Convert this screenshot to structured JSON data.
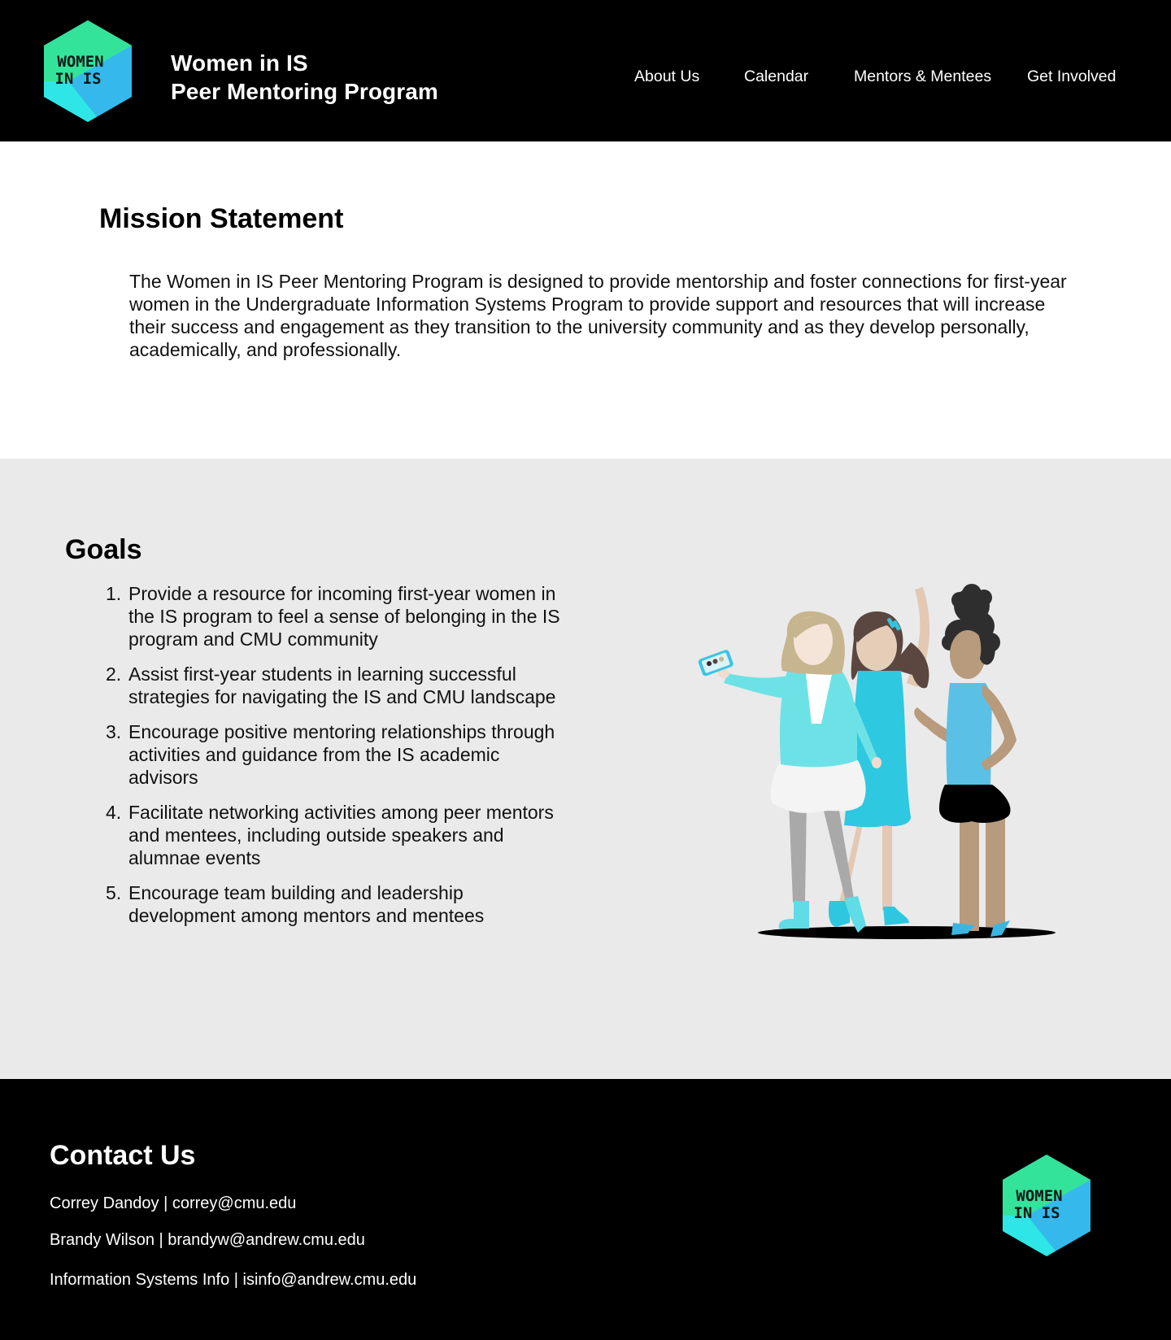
{
  "header": {
    "logo_text": [
      "WOMEN",
      "IN IS"
    ],
    "title_line1": "Women in IS",
    "title_line2": "Peer Mentoring Program",
    "nav": [
      {
        "label": "About Us"
      },
      {
        "label": "Calendar"
      },
      {
        "label": "Mentors & Mentees"
      },
      {
        "label": "Get Involved"
      }
    ]
  },
  "mission": {
    "heading": "Mission Statement",
    "body": "The Women in IS Peer Mentoring Program is designed to provide mentorship and foster connections for first-year women in the Undergraduate Information Systems Program to provide support and resources that will increase their success and engagement as they transition to the university community and as they develop personally, academically, and professionally."
  },
  "goals": {
    "heading": "Goals",
    "items": [
      {
        "number": "1.",
        "text": "Provide a resource for incoming first-year women in the IS program to feel a sense of belonging in the IS program and CMU community"
      },
      {
        "number": "2.",
        "text": "Assist first-year students in learning successful strategies for navigating the IS and CMU landscape"
      },
      {
        "number": "3.",
        "text": "Encourage positive mentoring relationships through activities and guidance from the IS academic advisors"
      },
      {
        "number": "4.",
        "text": "Facilitate networking activities among peer mentors and mentees, including outside speakers and alumnae events"
      },
      {
        "number": "5.",
        "text": "Encourage team building and leadership development among mentors and mentees"
      }
    ],
    "illustration": "three-women-selfie-illustration"
  },
  "footer": {
    "heading": "Contact Us",
    "contacts": [
      {
        "name": "Correy Dandoy",
        "separator": " | ",
        "email": "correy@cmu.edu"
      },
      {
        "name": "Brandy Wilson",
        "separator": " | ",
        "email": "brandyw@andrew.cmu.edu"
      },
      {
        "name": "Information Systems Info",
        "separator": " | ",
        "email": "isinfo@andrew.cmu.edu"
      }
    ],
    "logo_text": [
      "WOMEN",
      "IN IS"
    ]
  },
  "colors": {
    "header_bg": "#000000",
    "goals_bg": "#eaeaea",
    "footer_bg": "#000000",
    "logo_green": "#34e39a",
    "logo_blue": "#35b9ec",
    "logo_cyan": "#2ee6e6"
  }
}
